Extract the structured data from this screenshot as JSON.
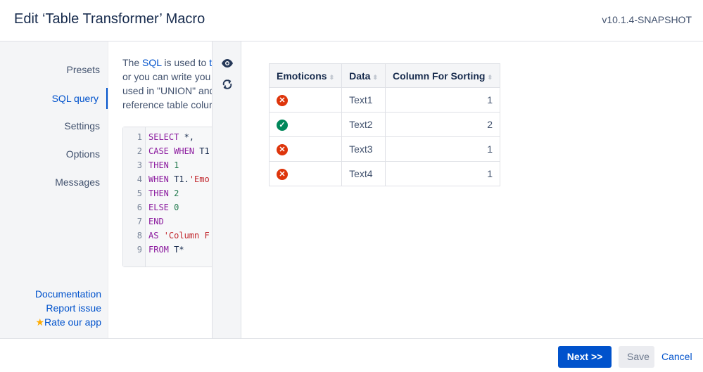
{
  "header": {
    "title": "Edit ‘Table Transformer’ Macro",
    "version": "v10.1.4-SNAPSHOT"
  },
  "sidebar": {
    "items": [
      {
        "label": "Presets"
      },
      {
        "label": "SQL query"
      },
      {
        "label": "Settings"
      },
      {
        "label": "Options"
      },
      {
        "label": "Messages"
      }
    ],
    "links": {
      "documentation": "Documentation",
      "report": "Report issue",
      "rate": "Rate our app"
    }
  },
  "description": {
    "l1a": "The ",
    "l1b": "SQL",
    "l1c": " is used to ",
    "l1d": "tr",
    "l2": "or you can write you",
    "l3": "used in \"UNION\" and",
    "l4": "reference table colur"
  },
  "code": {
    "lines": [
      "1",
      "2",
      "3",
      "4",
      "5",
      "6",
      "7",
      "8",
      "9"
    ],
    "l1k": "SELECT",
    "l1r": " *,",
    "l2k": "CASE WHEN",
    "l2r": " T1",
    "l3k": "THEN",
    "l3n": "1",
    "l4k": "WHEN",
    "l4r": " T1.",
    "l4s": "'Emo",
    "l5k": "THEN",
    "l5n": "2",
    "l6k": "ELSE",
    "l6n": "0",
    "l7k": "END",
    "l8k": "AS",
    "l8s": "'Column F",
    "l9k": "FROM",
    "l9r": " T*"
  },
  "tools": {
    "preview": "eye-icon",
    "refresh": "refresh-icon"
  },
  "table": {
    "headers": [
      "Emoticons",
      "Data",
      "Column For Sorting"
    ],
    "rows": [
      {
        "icon": "error",
        "data": "Text1",
        "sort": "1"
      },
      {
        "icon": "check",
        "data": "Text2",
        "sort": "2"
      },
      {
        "icon": "error",
        "data": "Text3",
        "sort": "1"
      },
      {
        "icon": "error",
        "data": "Text4",
        "sort": "1"
      }
    ]
  },
  "colors": {
    "error": "#de350b",
    "check": "#00875a",
    "accent": "#0052cc"
  },
  "footer": {
    "next": "Next >>",
    "save": "Save",
    "cancel": "Cancel"
  }
}
